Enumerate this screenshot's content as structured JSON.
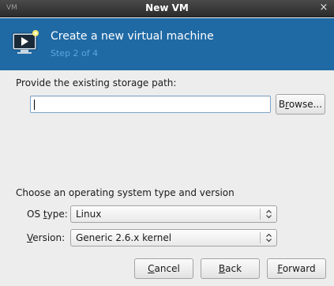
{
  "window": {
    "title": "New VM",
    "close_symbol": "×",
    "menu_symbol": "VM"
  },
  "banner": {
    "heading": "Create a new virtual machine",
    "step": "Step 2 of 4",
    "icon": "monitor-vm-icon",
    "background": "#1f6aa5"
  },
  "storage": {
    "label": "Provide the existing storage path:",
    "path_value": "",
    "browse_label_pre": "B",
    "browse_label_ul": "r",
    "browse_label_post": "owse..."
  },
  "os": {
    "section_label": "Choose an operating system type and version",
    "type_label_pre": "OS ",
    "type_label_ul": "t",
    "type_label_post": "ype:",
    "type_value": "Linux",
    "version_label_pre": "",
    "version_label_ul": "V",
    "version_label_post": "ersion:",
    "version_value": "Generic 2.6.x kernel"
  },
  "footer": {
    "cancel_ul": "C",
    "cancel_rest": "ancel",
    "back_ul": "B",
    "back_rest": "ack",
    "forward_ul": "F",
    "forward_rest": "orward"
  }
}
